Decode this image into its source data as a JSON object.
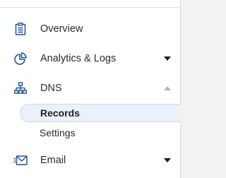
{
  "sidebar": {
    "items": [
      {
        "label": "Overview",
        "icon": "clipboard-icon"
      },
      {
        "label": "Analytics & Logs",
        "icon": "pie-chart-icon",
        "expand": "chevron-down-icon"
      },
      {
        "label": "DNS",
        "icon": "network-icon",
        "expand": "chevron-up-icon",
        "children": [
          {
            "label": "Records",
            "active": true
          },
          {
            "label": "Settings",
            "active": false
          }
        ]
      },
      {
        "label": "Email",
        "icon": "email-icon",
        "expand": "chevron-down-icon"
      }
    ]
  },
  "colors": {
    "icon": "#1f4e9c",
    "active_bg": "#eaf1fb",
    "chevron": "#1a1a1a",
    "chevron_muted": "#b5b5b5"
  }
}
